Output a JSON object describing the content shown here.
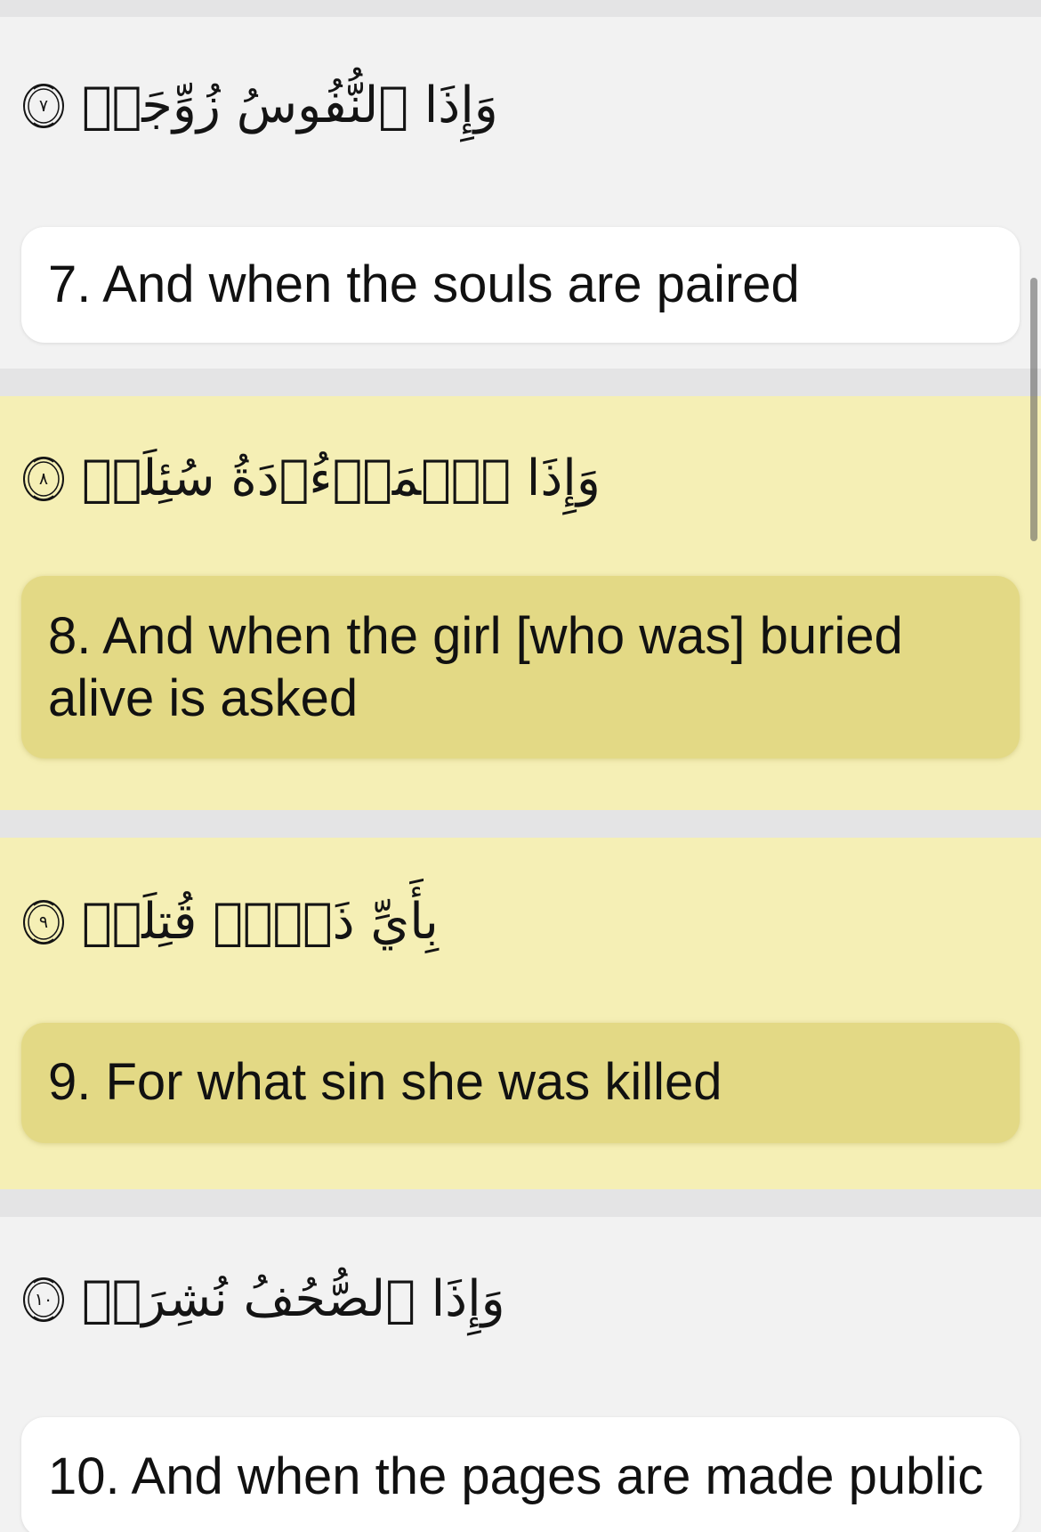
{
  "verses": [
    {
      "number": "7",
      "arabic": "وَإِذَا ٱلنُّفُوسُ زُوِّجَتۡ",
      "ayah_marker": "٧",
      "translation": "7. And when the souls are paired",
      "highlighted": false
    },
    {
      "number": "8",
      "arabic": "وَإِذَا ٱلۡمَوۡءُۥدَةُ سُئِلَتۡ",
      "ayah_marker": "٨",
      "translation": "8. And when the girl [who was] buried alive is asked",
      "highlighted": true
    },
    {
      "number": "9",
      "arabic": "بِأَيِّ ذَنۢبٖ قُتِلَتۡ",
      "ayah_marker": "٩",
      "translation": "9. For what sin she was killed",
      "highlighted": true
    },
    {
      "number": "10",
      "arabic": "وَإِذَا ٱلصُّحُفُ نُشِرَتۡ",
      "ayah_marker": "١٠",
      "translation": "10. And when the pages are made public",
      "highlighted": false
    }
  ],
  "colors": {
    "background": "#f2f2f2",
    "highlight_background": "#f5efb5",
    "card": "#ffffff",
    "highlight_card": "#e3d985",
    "separator": "#e4e4e5",
    "text": "#111111"
  },
  "icons": {
    "ayah_marker": "ornamental-ayah-end-marker-icon",
    "scrollbar": "scroll-indicator"
  }
}
